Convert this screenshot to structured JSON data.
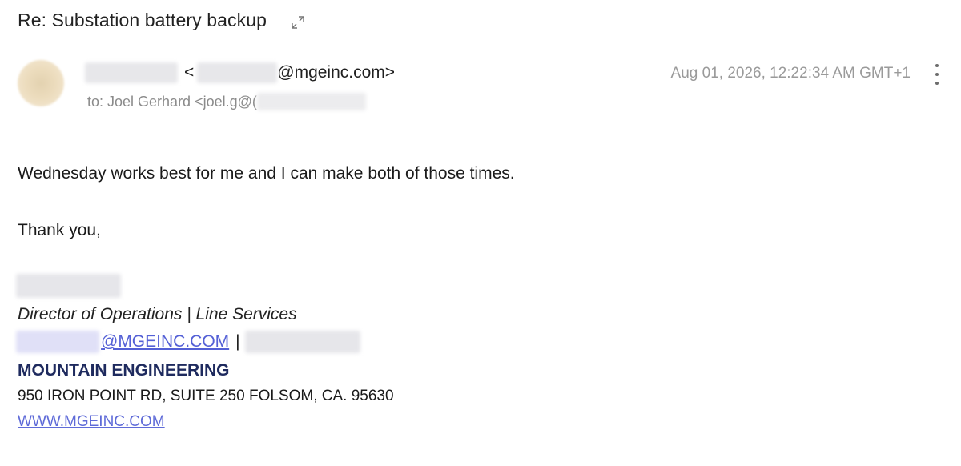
{
  "email": {
    "subject": "Re: Substation battery backup",
    "sender_domain": "@mgeinc.com>",
    "sender_angle_open": "<",
    "to_text": "to: Joel Gerhard <joel.g@(",
    "date": "Aug 01, 2026, 12:22:34 AM GMT+1"
  },
  "body": {
    "paragraph1": "Wednesday works best for me and I can make both of those times.",
    "closing": "Thank you,"
  },
  "signature": {
    "title": "Director of Operations | Line Services",
    "email_domain": "@MGEINC.COM",
    "pipe": "|",
    "company": "MOUNTAIN ENGINEERING",
    "address": "950 IRON POINT RD, SUITE 250 FOLSOM, CA. 95630",
    "website": "WWW.MGEINC.COM"
  },
  "icons": {
    "expand": "expand-icon",
    "more": "more-vertical-icon"
  },
  "colors": {
    "link": "#5460d6",
    "company": "#1e2a5e",
    "muted": "#9a9a9a"
  }
}
